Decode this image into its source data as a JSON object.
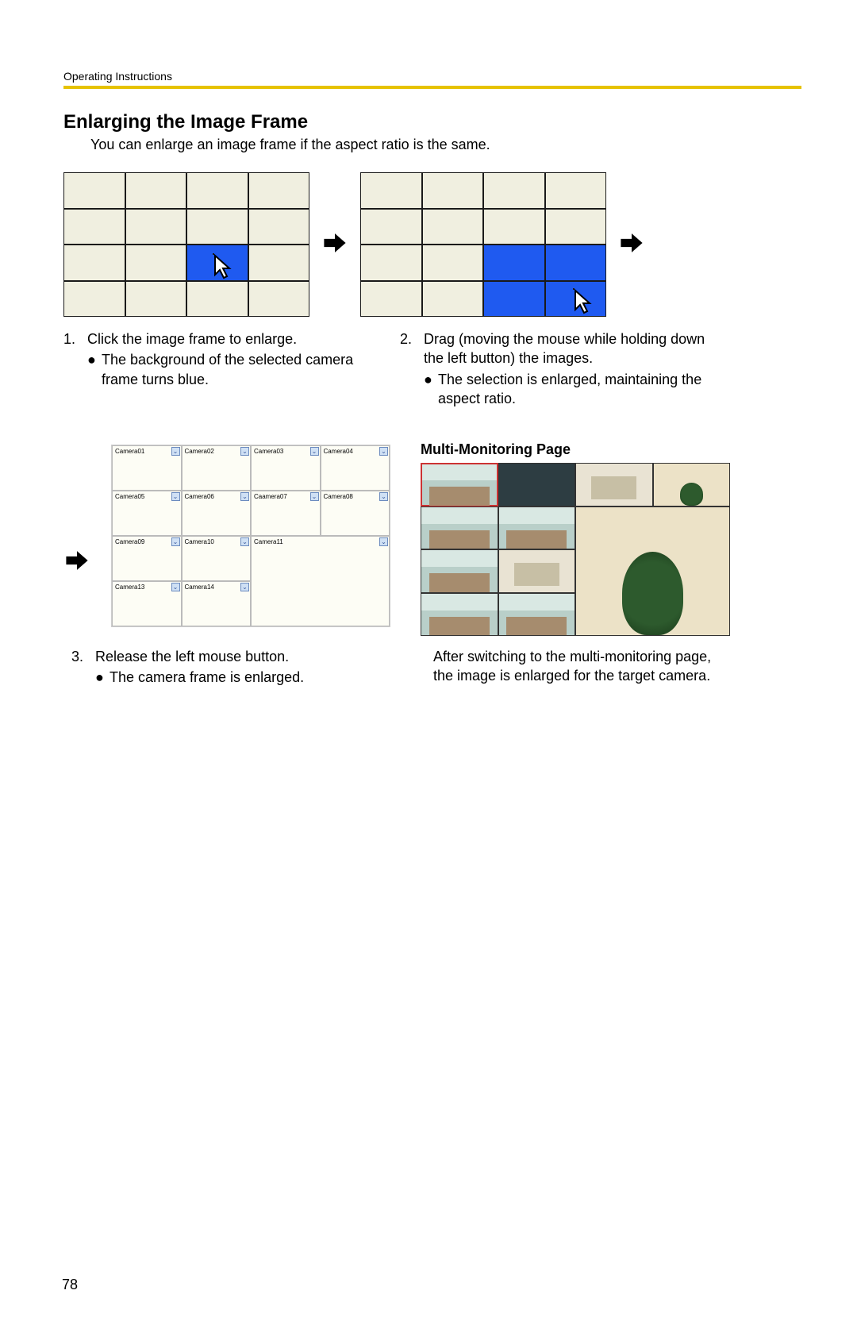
{
  "header": "Operating Instructions",
  "page_number": "78",
  "title": "Enlarging the Image Frame",
  "intro": "You can enlarge an image frame if the aspect ratio is the same.",
  "step1": {
    "num": "1.",
    "text": "Click the image frame to enlarge.",
    "bullet": "The background of the selected camera frame turns blue."
  },
  "step2": {
    "num": "2.",
    "text": "Drag (moving the mouse while holding down the left button) the images.",
    "bullet": "The selection is enlarged, maintaining the aspect ratio."
  },
  "step3": {
    "num": "3.",
    "text": "Release the left mouse button.",
    "bullet": "The camera frame is enlarged."
  },
  "multi_monitor_heading": "Multi-Monitoring Page",
  "step4_text": "After switching to the multi-monitoring page, the image is enlarged for the target camera.",
  "cameras": {
    "r1": [
      "Camera01",
      "Camera02",
      "Camera03",
      "Camera04"
    ],
    "r2": [
      "Camera05",
      "Camera06",
      "Caamera07",
      "Camera08"
    ],
    "r3": [
      "Camera09",
      "Camera10",
      "Camera11"
    ],
    "r4": [
      "Camera13",
      "Camera14"
    ]
  }
}
